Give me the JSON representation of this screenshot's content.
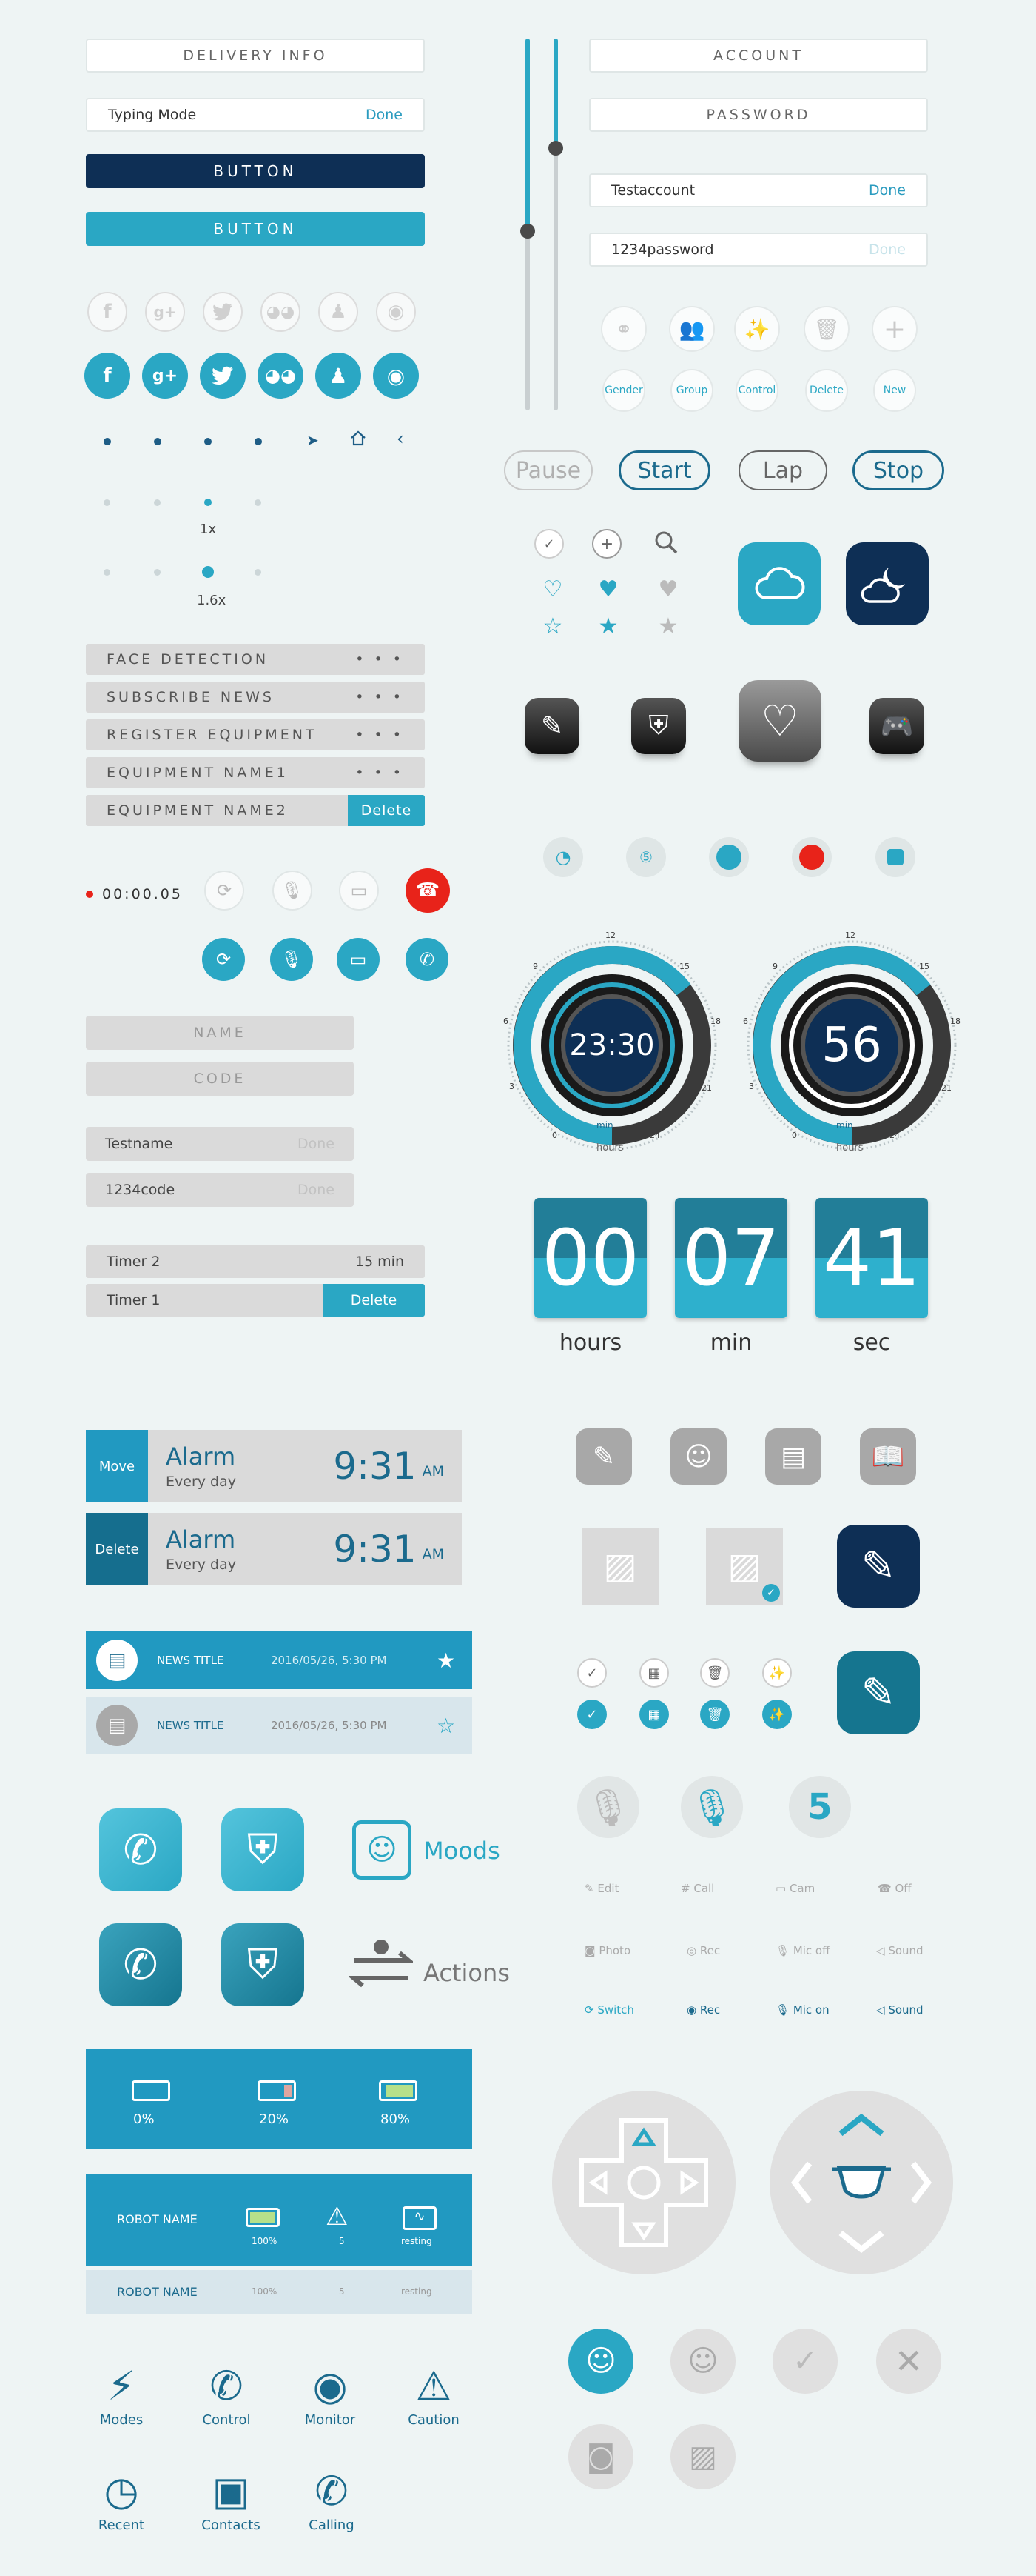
{
  "col_left": {
    "delivery_info": "DELIVERY INFO",
    "typing": {
      "label": "Typing Mode",
      "done": "Done"
    },
    "button_dark": "BUTTON",
    "button_light": "BUTTON",
    "social_icons": [
      "f",
      "g+",
      "twitter-bird",
      "chat-bubbles",
      "penguin",
      "weibo-eye"
    ],
    "zoom_labels": [
      "1x",
      "1.6x"
    ],
    "list_rows": [
      {
        "label": "FACE DETECTION",
        "more": "• • •"
      },
      {
        "label": "SUBSCRIBE NEWS",
        "more": "• • •"
      },
      {
        "label": "REGISTER EQUIPMENT",
        "more": "• • •"
      },
      {
        "label": "EQUIPMENT NAME1",
        "more": "• • •"
      },
      {
        "label": "EQUIPMENT NAME2",
        "action": "Delete"
      }
    ],
    "rec_time": "00:00.05",
    "fields": {
      "name": "NAME",
      "code": "CODE"
    },
    "filled": [
      {
        "value": "Testname",
        "done": "Done"
      },
      {
        "value": "1234code",
        "done": "Done"
      }
    ],
    "timers": [
      {
        "label": "Timer 2",
        "value": "15 min"
      },
      {
        "label": "Timer 1",
        "action": "Delete"
      }
    ]
  },
  "col_right": {
    "account": "ACCOUNT",
    "password": "PASSWORD",
    "filled": [
      {
        "value": "Testaccount",
        "done": "Done"
      },
      {
        "value": "1234password",
        "done": "Done"
      }
    ],
    "accounts_labels": [
      "Gender",
      "Group",
      "Control",
      "Delete",
      "New"
    ],
    "pills": [
      "Pause",
      "Start",
      "Lap",
      "Stop"
    ],
    "clocks": [
      {
        "value": "23:30",
        "label": "min",
        "sub": "hours",
        "ticks": [
          "12",
          "15",
          "18",
          "21",
          "24",
          "0",
          "3",
          "6",
          "9"
        ]
      },
      {
        "value": "56",
        "label": "min",
        "sub": "hours",
        "ticks": [
          "12",
          "15",
          "18",
          "21",
          "24",
          "0",
          "3",
          "6",
          "9"
        ]
      }
    ],
    "flip": [
      {
        "value": "00",
        "label": "hours"
      },
      {
        "value": "07",
        "label": "min"
      },
      {
        "value": "41",
        "label": "sec"
      }
    ]
  },
  "alarms": [
    {
      "side": "Move",
      "title": "Alarm",
      "sub": "Every day",
      "time": "9:31",
      "ampm": "AM"
    },
    {
      "side": "Delete",
      "title": "Alarm",
      "sub": "Every day",
      "time": "9:31",
      "ampm": "AM"
    }
  ],
  "news": [
    {
      "title": "NEWS TITLE",
      "date": "2016/05/26, 5:30 PM"
    },
    {
      "title": "NEWS TITLE",
      "date": "2016/05/26, 5:30 PM"
    }
  ],
  "features": {
    "moods": "Moods",
    "actions": "Actions"
  },
  "battery": [
    "0%",
    "20%",
    "80%"
  ],
  "robot": {
    "name": "ROBOT NAME",
    "values": [
      "100%",
      "5",
      "resting"
    ]
  },
  "categories": [
    "Modes",
    "Control",
    "Monitor",
    "Caution",
    "Recent",
    "Contacts",
    "Calling"
  ],
  "mic_number": "5",
  "labeled_icons": {
    "row1": [
      "Edit",
      "Call",
      "Cam",
      "Off"
    ],
    "row2": [
      "Photo",
      "Rec",
      "Mic off",
      "Sound"
    ],
    "row3": [
      "Switch",
      "Rec",
      "Mic on",
      "Sound"
    ]
  },
  "colors": {
    "accent": "#2aa7c4",
    "navy": "#0e2f55",
    "deep": "#1b6a8d",
    "bg": "#eef4f4",
    "red": "#e8231a"
  }
}
